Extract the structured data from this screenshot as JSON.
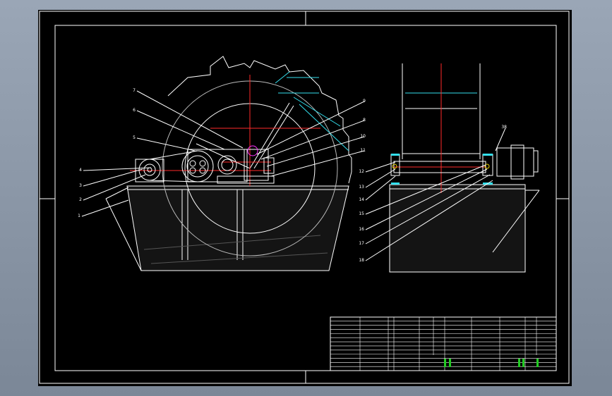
{
  "drawing": {
    "colors": {
      "background": "#000000",
      "lines": "#ffffff",
      "center": "#ff2a2a",
      "cyan": "#33e0ee",
      "green": "#22cc22",
      "yellow": "#e8d200",
      "magenta": "#ff33ff"
    },
    "balloons_front": [
      "7",
      "6",
      "5",
      "4",
      "3",
      "2",
      "1",
      "9",
      "8",
      "10",
      "11"
    ],
    "balloons_side": [
      "38",
      "12",
      "13",
      "14",
      "15",
      "16",
      "17",
      "18",
      "19"
    ],
    "title_block": {
      "rows": 12,
      "row_labels": [
        "",
        "",
        "",
        "",
        "",
        "",
        "",
        "",
        "",
        "",
        "",
        ""
      ]
    }
  }
}
